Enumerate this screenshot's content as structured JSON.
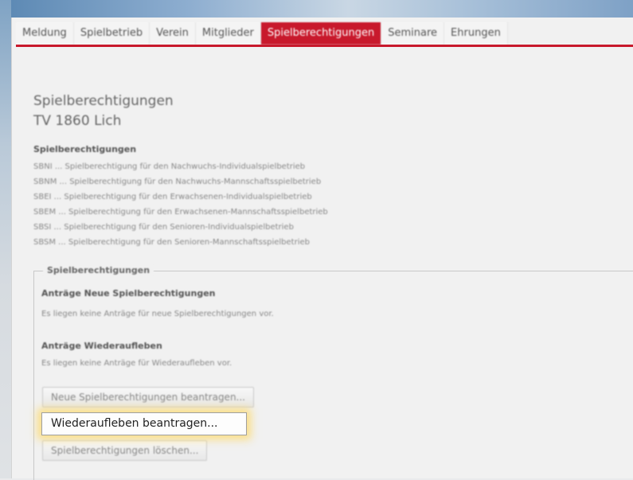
{
  "tabs": [
    {
      "label": "Meldung",
      "active": false
    },
    {
      "label": "Spielbetrieb",
      "active": false
    },
    {
      "label": "Verein",
      "active": false
    },
    {
      "label": "Mitglieder",
      "active": false
    },
    {
      "label": "Spielberechtigungen",
      "active": true
    },
    {
      "label": "Seminare",
      "active": false
    },
    {
      "label": "Ehrungen",
      "active": false
    }
  ],
  "page": {
    "title": "Spielberechtigungen",
    "club": "TV 1860 Lich"
  },
  "legend": {
    "heading": "Spielberechtigungen",
    "items": [
      "SBNI ... Spielberechtigung für den Nachwuchs-Individualspielbetrieb",
      "SBNM ... Spielberechtigung für den Nachwuchs-Mannschaftsspielbetrieb",
      "SBEI ... Spielberechtigung für den Erwachsenen-Individualspielbetrieb",
      "SBEM ... Spielberechtigung für den Erwachsenen-Mannschaftsspielbetrieb",
      "SBSI ... Spielberechtigung für den Senioren-Individualspielbetrieb",
      "SBSM ... Spielberechtigung für den Senioren-Mannschaftsspielbetrieb"
    ]
  },
  "fieldset": {
    "legend": "Spielberechtigungen",
    "new_requests_heading": "Anträge Neue Spielberechtigungen",
    "new_requests_text": "Es liegen keine Anträge für neue Spielberechtigungen vor.",
    "revival_heading": "Anträge Wiederaufleben",
    "revival_text": "Es liegen keine Anträge für Wiederaufleben vor."
  },
  "buttons": {
    "request_new": "Neue Spielberechtigungen beantragen...",
    "request_revival": "Wiederaufleben beantragen...",
    "delete": "Spielberechtigungen löschen..."
  },
  "colors": {
    "accent": "#c8192c",
    "focus_glow": "#fcdc78"
  }
}
